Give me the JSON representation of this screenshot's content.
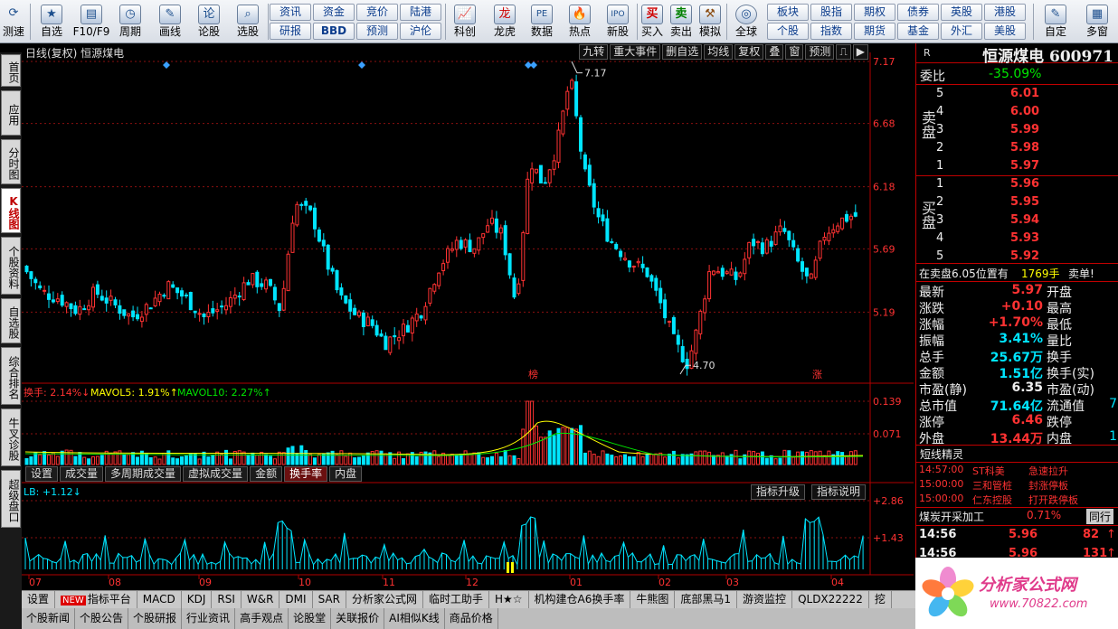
{
  "toolbar": {
    "icon_buttons": [
      {
        "label": "测速",
        "icon": "speed-icon"
      },
      {
        "label": "自选",
        "icon": "star-icon"
      },
      {
        "label": "F10/F9",
        "icon": "f10-icon"
      },
      {
        "label": "周期",
        "icon": "clock-icon"
      },
      {
        "label": "画线",
        "icon": "pen-icon"
      },
      {
        "label": "论股",
        "icon": "discuss-icon"
      },
      {
        "label": "选股",
        "icon": "magnifier-icon"
      }
    ],
    "text_buttons_row1": [
      "资讯",
      "资金",
      "竞价",
      "陆港"
    ],
    "text_buttons_row2": [
      "研报",
      "BBD",
      "预测",
      "沪伦"
    ],
    "icon_buttons2": [
      {
        "label": "科创",
        "icon": "chart-icon"
      },
      {
        "label": "龙虎",
        "icon": "dragon-icon"
      },
      {
        "label": "数据",
        "icon": "pe-icon"
      },
      {
        "label": "热点",
        "icon": "fire-icon"
      },
      {
        "label": "新股",
        "icon": "ipo-icon"
      }
    ],
    "trade_buttons": [
      {
        "label": "买入",
        "glyph": "买",
        "color": "#d00000"
      },
      {
        "label": "卖出",
        "glyph": "卖",
        "color": "#008000"
      },
      {
        "label": "模拟",
        "glyph": "⚒",
        "color": "#8a4b10"
      }
    ],
    "globe_button": "全球",
    "market_row1": [
      "板块",
      "股指",
      "期权",
      "债券",
      "英股",
      "港股"
    ],
    "market_row2": [
      "个股",
      "指数",
      "期货",
      "基金",
      "外汇",
      "美股"
    ],
    "right_buttons": [
      "自定",
      "多窗"
    ]
  },
  "left_tabs": [
    {
      "label": "首页",
      "active": false
    },
    {
      "label": "应用",
      "active": false
    },
    {
      "label": "分时图",
      "active": false
    },
    {
      "label": "K线图",
      "active": true
    },
    {
      "label": "个股资料",
      "active": false
    },
    {
      "label": "自选股",
      "active": false
    },
    {
      "label": "综合排名",
      "active": false
    },
    {
      "label": "牛叉诊股",
      "active": false
    },
    {
      "label": "超级盘口",
      "active": false
    }
  ],
  "chart": {
    "title": "日线(复权)  恒源煤电",
    "tools": [
      "九转",
      "重大事件",
      "删自选",
      "均线",
      "复权",
      "叠",
      "窗",
      "预测",
      "⎍",
      "▶"
    ],
    "price_labels": [
      "7.17",
      "6.68",
      "6.18",
      "5.69",
      "5.19"
    ],
    "high_label": "7.17",
    "low_label": "4.70",
    "markers": [
      "榜",
      "涨"
    ],
    "volume_legend": {
      "turnover": "换手: 2.14%↓",
      "mavol5": "MAVOL5: 1.91%↑",
      "mavol10": "MAVOL10: 2.27%↑"
    },
    "volume_scale": [
      "0.139",
      "0.071"
    ],
    "volume_tabs": [
      "设置",
      "成交量",
      "多周期成交量",
      "虚拟成交量",
      "金额",
      "换手率",
      "内盘"
    ],
    "volume_tab_active": "换手率",
    "lb_legend": "LB: +1.12↓",
    "lb_buttons": [
      "指标升级",
      "指标说明"
    ],
    "lb_scale": [
      "+2.86",
      "+1.43"
    ],
    "month_labels": [
      "07",
      "08",
      "09",
      "10",
      "11",
      "12",
      "01",
      "02",
      "03",
      "04"
    ]
  },
  "bottom_tabs": [
    {
      "label": "设置",
      "new": false
    },
    {
      "label": "指标平台",
      "new": true
    },
    {
      "label": "MACD",
      "new": false
    },
    {
      "label": "KDJ",
      "new": false
    },
    {
      "label": "RSI",
      "new": false
    },
    {
      "label": "W&R",
      "new": false
    },
    {
      "label": "DMI",
      "new": false
    },
    {
      "label": "SAR",
      "new": false
    },
    {
      "label": "分析家公式网",
      "new": false
    },
    {
      "label": "临时工助手",
      "new": false
    },
    {
      "label": "H★☆",
      "new": false
    },
    {
      "label": "机构建仓A6换手率",
      "new": false
    },
    {
      "label": "牛熊图",
      "new": false
    },
    {
      "label": "底部黑马1",
      "new": false
    },
    {
      "label": "游资监控",
      "new": false
    },
    {
      "label": "QLDX22222",
      "new": false
    },
    {
      "label": "挖",
      "new": false
    }
  ],
  "bottom_tabs2": [
    "个股新闻",
    "个股公告",
    "个股研报",
    "行业资讯",
    "高手观点",
    "论股堂",
    "关联报价",
    "AI相似K线",
    "商品价格"
  ],
  "quote": {
    "r": "R",
    "name": "恒源煤电 600971",
    "weibi_label": "委比",
    "weibi_value": "-35.09%",
    "sell_side": "卖盘",
    "buy_side": "买盘",
    "sell": [
      {
        "n": "5",
        "price": "6.01"
      },
      {
        "n": "4",
        "price": "6.00"
      },
      {
        "n": "3",
        "price": "5.99"
      },
      {
        "n": "2",
        "price": "5.98"
      },
      {
        "n": "1",
        "price": "5.97"
      }
    ],
    "buy": [
      {
        "n": "1",
        "price": "5.96"
      },
      {
        "n": "2",
        "price": "5.95"
      },
      {
        "n": "3",
        "price": "5.94"
      },
      {
        "n": "4",
        "price": "5.93"
      },
      {
        "n": "5",
        "price": "5.92"
      }
    ],
    "sell_notice": "在卖盘6.05位置有",
    "sell_notice_qty": "1769手",
    "sell_notice_tail": "卖单!",
    "stats": [
      {
        "l1": "最新",
        "v1": "5.97",
        "c1": "red",
        "l2": "开盘",
        "v2": ""
      },
      {
        "l1": "涨跌",
        "v1": "+0.10",
        "c1": "red",
        "l2": "最高",
        "v2": ""
      },
      {
        "l1": "涨幅",
        "v1": "+1.70%",
        "c1": "red",
        "l2": "最低",
        "v2": ""
      },
      {
        "l1": "振幅",
        "v1": "3.41%",
        "c1": "cyan",
        "l2": "量比",
        "v2": ""
      },
      {
        "l1": "总手",
        "v1": "25.67万",
        "c1": "cyan",
        "l2": "换手",
        "v2": ""
      },
      {
        "l1": "金额",
        "v1": "1.51亿",
        "c1": "cyan",
        "l2": "换手(实)",
        "v2": ""
      },
      {
        "l1": "市盈(静)",
        "v1": "6.35",
        "c1": "white",
        "l2": "市盈(动)",
        "v2": ""
      },
      {
        "l1": "总市值",
        "v1": "71.64亿",
        "c1": "cyan",
        "l2": "流通值",
        "v2": "7"
      },
      {
        "l1": "涨停",
        "v1": "6.46",
        "c1": "red",
        "l2": "跌停",
        "v2": ""
      },
      {
        "l1": "外盘",
        "v1": "13.44万",
        "c1": "red",
        "l2": "内盘",
        "v2": "1"
      }
    ],
    "sprite_title": "短线精灵",
    "sprites": [
      {
        "time": "14:57:00",
        "name": "ST科美",
        "event": "急速拉升"
      },
      {
        "time": "15:00:00",
        "name": "三和管桩",
        "event": "封涨停板"
      },
      {
        "time": "15:00:00",
        "name": "仁东控股",
        "event": "打开跌停板"
      }
    ],
    "sector_name": "煤炭开采加工",
    "sector_change": "0.71%",
    "sector_btn": "同行",
    "ticks": [
      {
        "time": "14:56",
        "price": "5.96",
        "vol": "82",
        "dir": "up"
      },
      {
        "time": "14:56",
        "price": "5.96",
        "vol": "131",
        "dir": "up"
      }
    ]
  },
  "logo": {
    "title": "分析家公式网",
    "url": "www.70822.com"
  }
}
